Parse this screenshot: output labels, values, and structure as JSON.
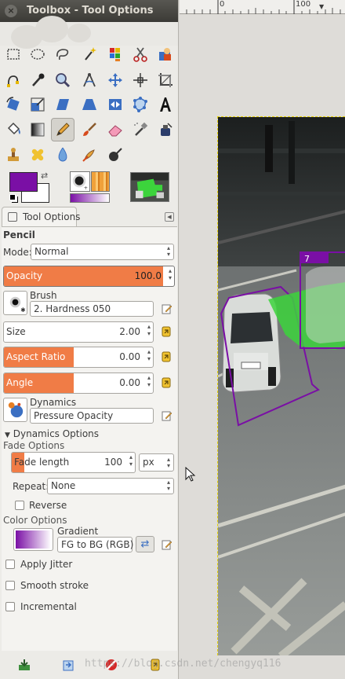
{
  "window": {
    "title": "Toolbox - Tool Options"
  },
  "ruler": {
    "label_0": "0",
    "label_100": "100"
  },
  "tool_options": {
    "tab_label": "Tool Options",
    "tool_name": "Pencil",
    "mode": {
      "label": "Mode:",
      "value": "Normal"
    },
    "opacity": {
      "label": "Opacity",
      "value": "100.0",
      "fraction": 1.0
    },
    "brush": {
      "label": "Brush",
      "value": "2. Hardness 050"
    },
    "size": {
      "label": "Size",
      "value": "2.00",
      "fraction": 0.0
    },
    "aspect_ratio": {
      "label": "Aspect Ratio",
      "value": "0.00",
      "fraction": 0.5
    },
    "angle": {
      "label": "Angle",
      "value": "0.00",
      "fraction": 0.5
    },
    "dynamics": {
      "label": "Dynamics",
      "value": "Pressure Opacity"
    },
    "dynamics_options": {
      "label": "Dynamics Options"
    },
    "fade_options": {
      "label": "Fade Options"
    },
    "fade_length": {
      "label": "Fade length",
      "value": "100",
      "unit": "px",
      "fraction": 0.1
    },
    "repeat": {
      "label": "Repeat:",
      "value": "None"
    },
    "reverse": {
      "label": "Reverse",
      "checked": false
    },
    "color_options": {
      "label": "Color Options"
    },
    "gradient": {
      "label": "Gradient",
      "value": "FG to BG (RGB)"
    },
    "apply_jitter": {
      "label": "Apply Jitter",
      "checked": false
    },
    "smooth_stroke": {
      "label": "Smooth stroke",
      "checked": false
    },
    "incremental": {
      "label": "Incremental",
      "checked": false
    }
  },
  "colors": {
    "foreground": "#7a0fa5",
    "background": "#ffffff",
    "accent": "#f07c46",
    "annotation_green": "#3cd43c",
    "annotation_purple": "#7a0fa5"
  },
  "canvas": {
    "box_label": "7"
  },
  "icons": [
    "rect-select-icon",
    "ellipse-select-icon",
    "free-select-icon",
    "fuzzy-select-icon",
    "select-by-color-icon",
    "scissors-select-icon",
    "foreground-select-icon",
    "paths-icon",
    "color-picker-icon",
    "zoom-icon",
    "measure-icon",
    "move-icon",
    "align-icon",
    "crop-icon",
    "rotate-icon",
    "scale-icon",
    "shear-icon",
    "perspective-icon",
    "flip-icon",
    "cage-transform-icon",
    "text-icon",
    "bucket-fill-icon",
    "blend-icon",
    "pencil-icon",
    "paintbrush-icon",
    "eraser-icon",
    "airbrush-icon",
    "ink-icon",
    "clone-icon",
    "heal-icon",
    "blur-icon",
    "smudge-icon",
    "dodge-burn-icon"
  ],
  "watermark": "https://blog.csdn.net/chengyq116"
}
